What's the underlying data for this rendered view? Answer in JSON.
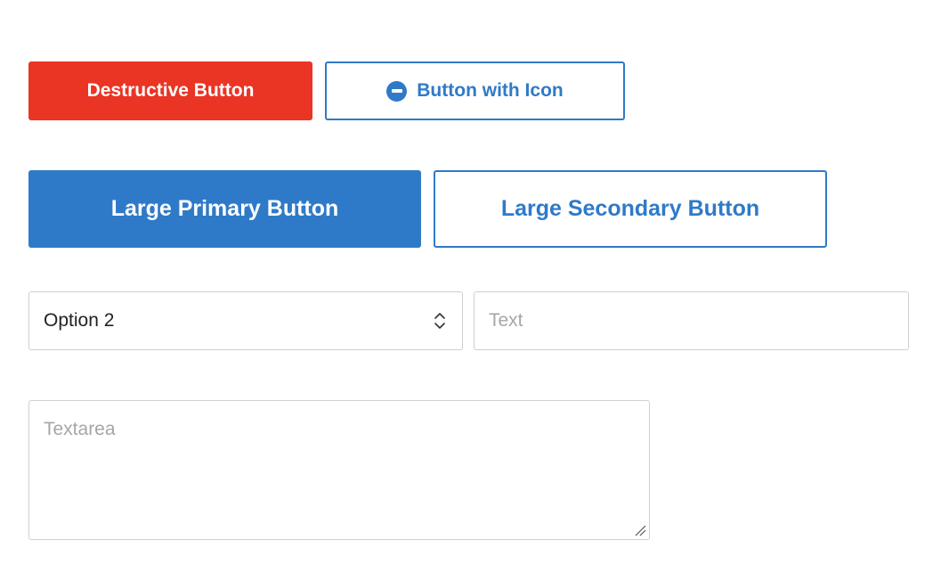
{
  "buttons": {
    "destructive_label": "Destructive Button",
    "icon_button_label": "Button with Icon",
    "icon_button_icon": "minus-circle-icon",
    "large_primary_label": "Large Primary Button",
    "large_secondary_label": "Large Secondary Button"
  },
  "select": {
    "value": "Option 2",
    "icon": "updown-chevron-icon"
  },
  "text_input": {
    "value": "",
    "placeholder": "Text"
  },
  "textarea": {
    "value": "",
    "placeholder": "Textarea"
  },
  "colors": {
    "destructive": "#ea3424",
    "primary": "#2f7ac8",
    "border": "#cfcfcf",
    "placeholder": "#a6a6a6",
    "background": "#ffffff"
  }
}
